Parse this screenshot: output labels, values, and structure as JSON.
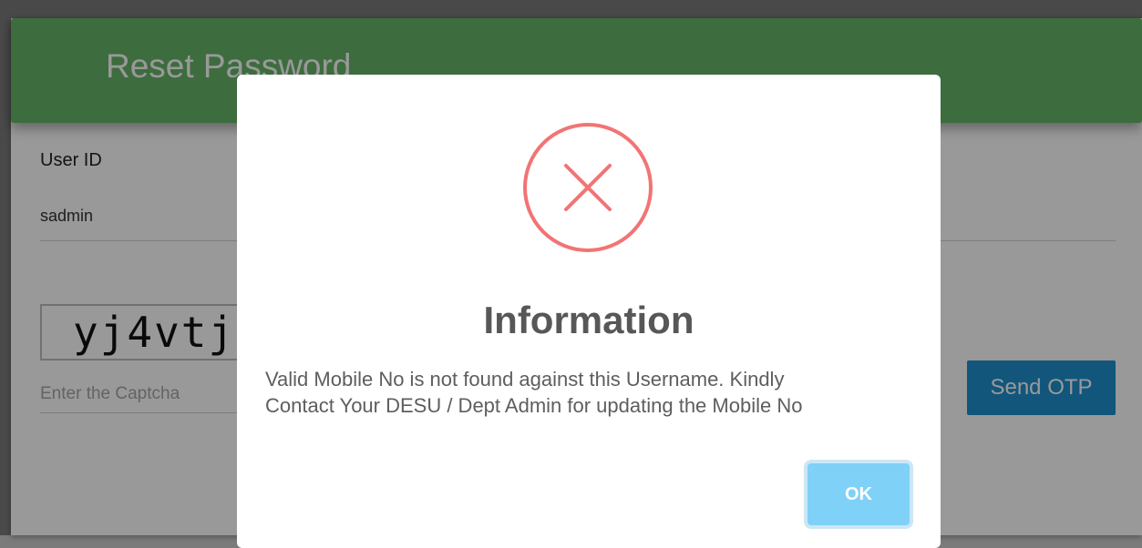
{
  "form": {
    "title": "Reset Password",
    "userid_label": "User ID",
    "userid_value": "sadmin",
    "captcha_text": "yj4vtj",
    "captcha_placeholder": "Enter the Captcha",
    "send_otp_label": "Send OTP"
  },
  "dialog": {
    "icon": "error-x-icon",
    "title": "Information",
    "message_line1": "Valid Mobile No is not found against this Username. Kindly",
    "message_line2": "Contact Your DESU / Dept Admin for updating the Mobile No",
    "ok_label": "OK"
  },
  "colors": {
    "header": "#67b468",
    "send_otp": "#1f8fcf",
    "error_icon": "#f27474",
    "ok_button": "#7fd1f7"
  }
}
